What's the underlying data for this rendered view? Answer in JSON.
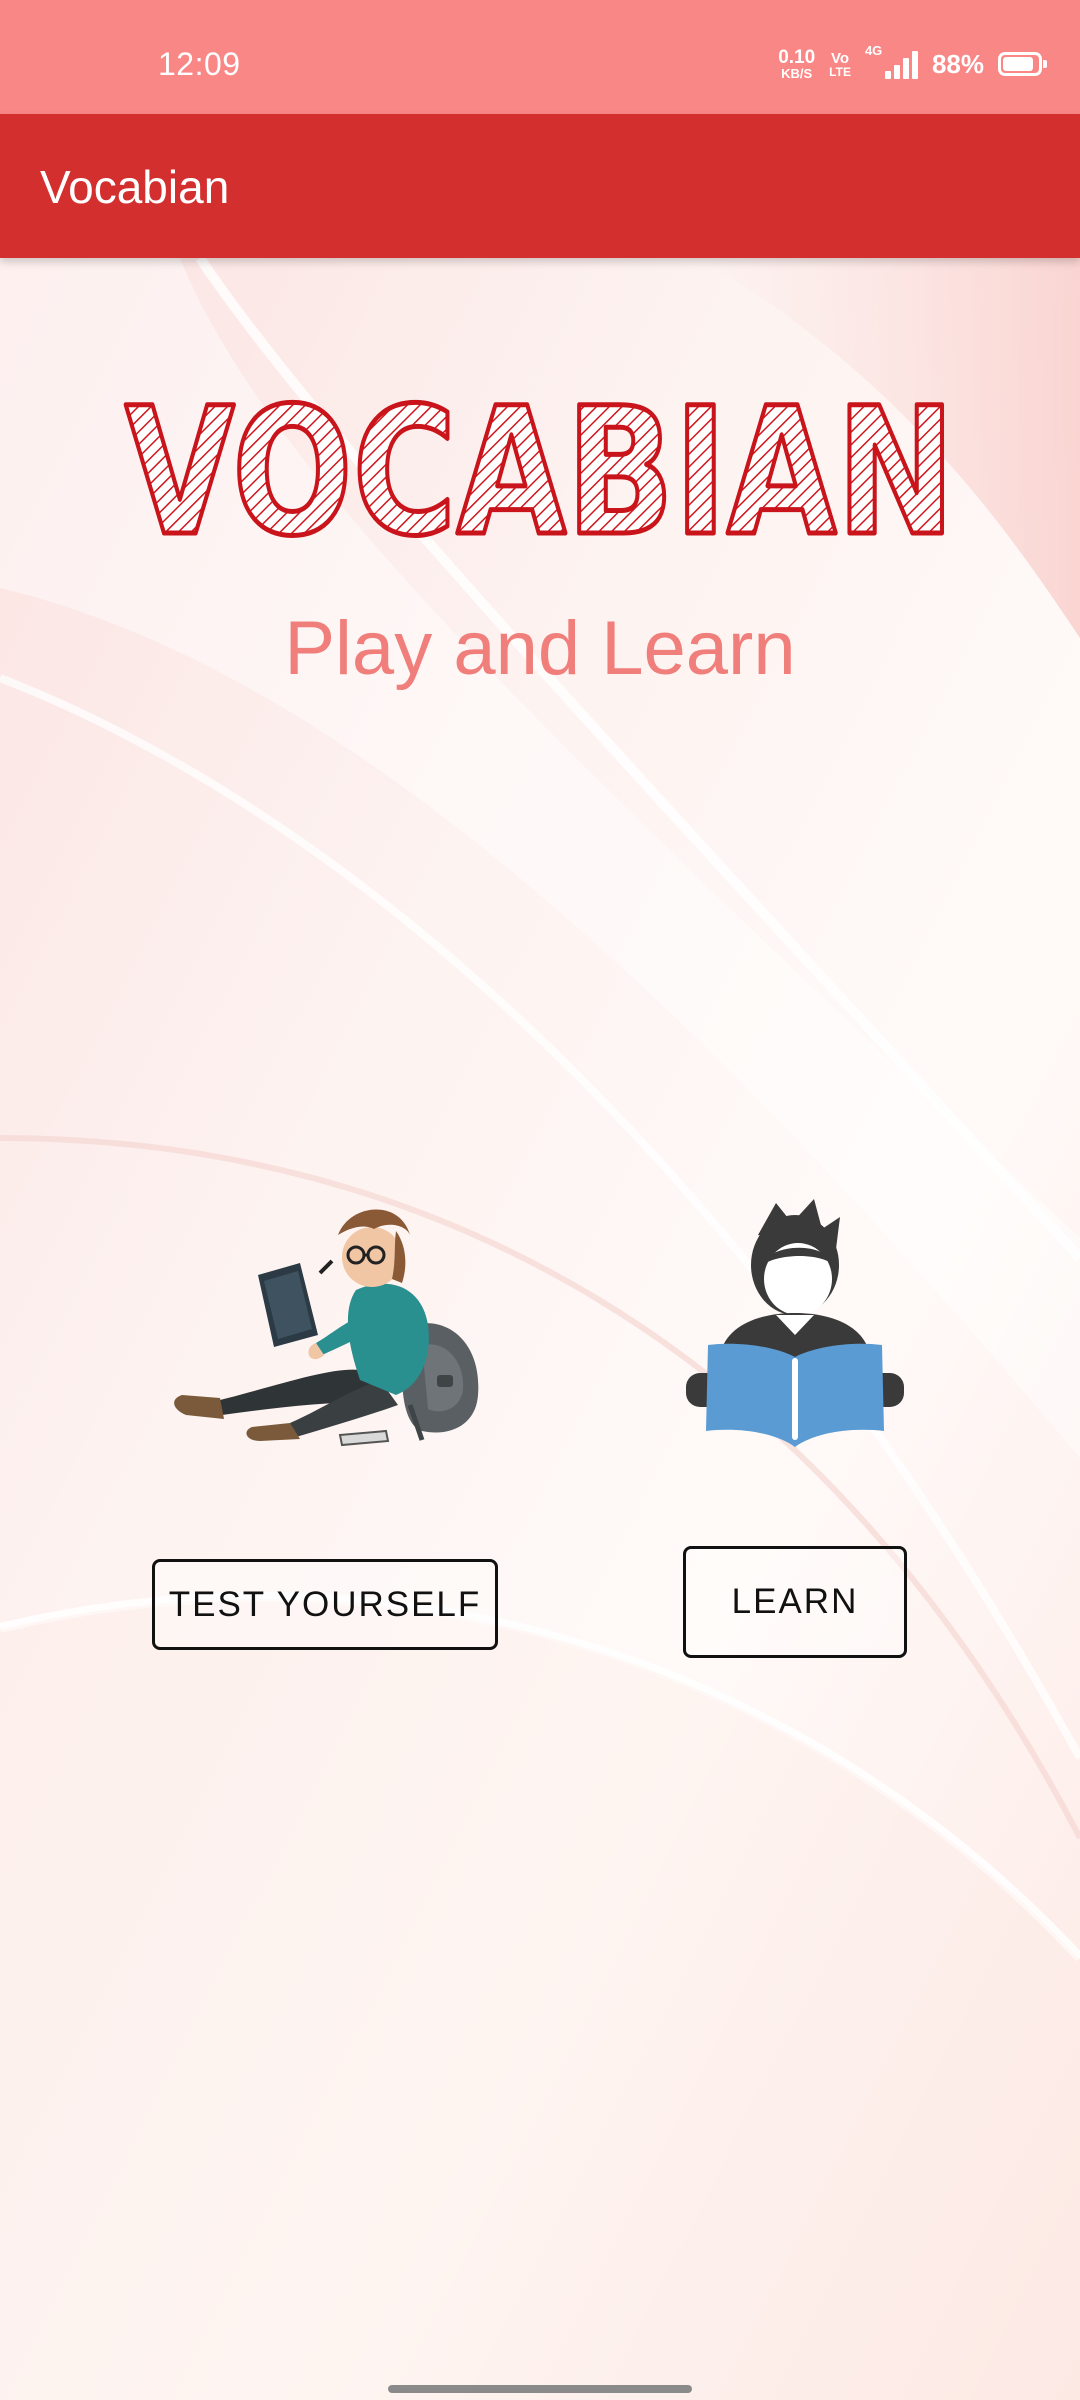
{
  "status_bar": {
    "time": "12:09",
    "net_speed_value": "0.10",
    "net_speed_unit": "KB/S",
    "volte_top": "Vo",
    "volte_bottom": "LTE",
    "network_type": "4G",
    "battery_percent": "88%",
    "battery_level": 0.88,
    "icons": [
      "network-speed-icon",
      "volte-icon",
      "signal-icon",
      "battery-icon"
    ]
  },
  "app_bar": {
    "title": "Vocabian",
    "color": "#d32f2f"
  },
  "hero": {
    "logo_text": "VOCABIAN",
    "tagline": "Play and Learn"
  },
  "actions": {
    "test_label": "TEST YOURSELF",
    "learn_label": "LEARN"
  },
  "illustrations": [
    "student-reading-illustration",
    "person-reading-book-icon"
  ],
  "colors": {
    "status_bar": "#f98786",
    "accent": "#d32f2f",
    "tagline": "#f07e7b",
    "book_blue": "#5a9bd4"
  }
}
